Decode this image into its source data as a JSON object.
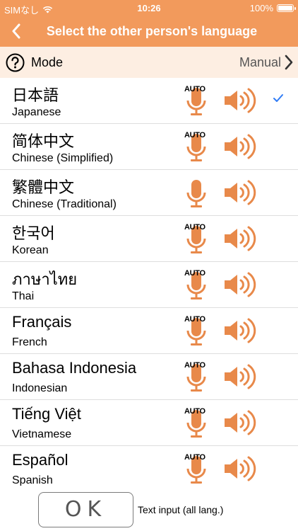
{
  "status_bar": {
    "carrier": "SIMなし",
    "time": "10:26",
    "battery": "100%"
  },
  "nav": {
    "title": "Select the other person's language",
    "back_icon": "chevron-left-icon"
  },
  "mode": {
    "label": "Mode",
    "value": "Manual"
  },
  "colors": {
    "accent": "#f29a5c",
    "icon": "#e8894a",
    "check": "#2f7cf6",
    "mode_bg": "#fdeee2"
  },
  "languages": [
    {
      "native": "日本語",
      "english": "Japanese",
      "auto": "AUTO",
      "selected": true
    },
    {
      "native": "简体中文",
      "english": "Chinese (Simplified)",
      "auto": "AUTO",
      "selected": false
    },
    {
      "native": "繁體中文",
      "english": "Chinese (Traditional)",
      "auto": "",
      "selected": false
    },
    {
      "native": "한국어",
      "english": "Korean",
      "auto": "AUTO",
      "selected": false
    },
    {
      "native": "ภาษาไทย",
      "english": "Thai",
      "auto": "AUTO",
      "selected": false
    },
    {
      "native": "Français",
      "english": "French",
      "auto": "AUTO",
      "selected": false
    },
    {
      "native": "Bahasa Indonesia",
      "english": "Indonesian",
      "auto": "AUTO",
      "selected": false
    },
    {
      "native": "Tiếng Việt",
      "english": "Vietnamese",
      "auto": "AUTO",
      "selected": false
    },
    {
      "native": "Español",
      "english": "Spanish",
      "auto": "AUTO",
      "selected": false
    }
  ],
  "bottom": {
    "ok_label": "OK",
    "text_input_label": "Text input (all lang.)"
  }
}
